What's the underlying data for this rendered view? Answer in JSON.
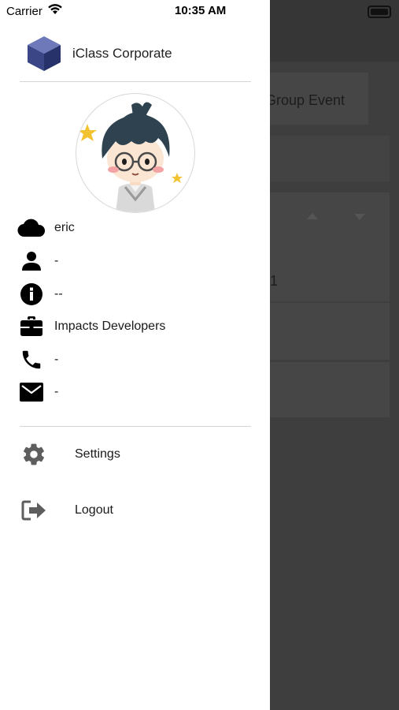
{
  "status_bar": {
    "carrier": "Carrier",
    "time": "10:35 AM"
  },
  "background": {
    "card_label": "Group Event",
    "row_value": "1"
  },
  "drawer": {
    "brand": {
      "title": "iClass Corporate",
      "logo_icon": "cube-logo-icon"
    },
    "profile": {
      "avatar": "cartoon-avatar",
      "fields": [
        {
          "icon": "cloud-icon",
          "value": "eric"
        },
        {
          "icon": "person-icon",
          "value": "-"
        },
        {
          "icon": "info-icon",
          "value": "--"
        },
        {
          "icon": "briefcase-icon",
          "value": "Impacts Developers"
        },
        {
          "icon": "phone-icon",
          "value": "-"
        },
        {
          "icon": "mail-icon",
          "value": "-"
        }
      ]
    },
    "menu": [
      {
        "icon": "gear-icon",
        "label": "Settings"
      },
      {
        "icon": "logout-icon",
        "label": "Logout"
      }
    ]
  }
}
